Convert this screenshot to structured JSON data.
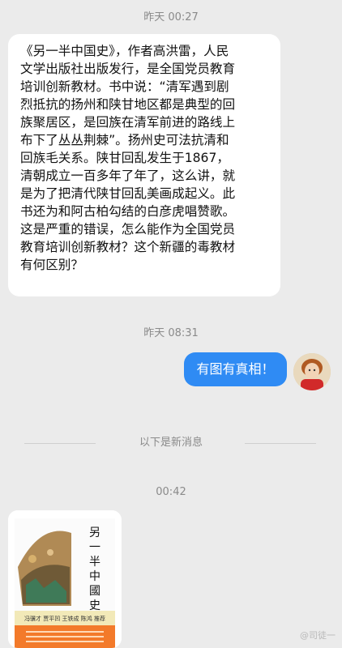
{
  "messages": [
    {
      "time": "昨天 00:27",
      "text": "《另一半中国史》，作者高洪雷，人民\n文学出版社出版发行，是全国党员教育\n培训创新教材。书中说：“清军遇到剧\n烈抵抗的扬州和陕甘地区都是典型的回\n族聚居区，是回族在清军前进的路线上\n布下了丛丛荆棘”。扬州史可法抗清和\n回族毛关系。陕甘回乱发生于1867，\n清朝成立一百多年了年了，这么讲，就\n是为了把清代陕甘回乱美画成起义。此\n书还为和阿古柏勾结的白彦虎唱赞歌。\n这是严重的错误，怎么能作为全国党员\n教育培训创新教材？这个新疆的毒教材\n有何区别？"
    },
    {
      "time": "昨天 08:31",
      "text": "有图有真相！"
    }
  ],
  "divider_label": "以下是新消息",
  "time_3": "00:42",
  "book_cover": {
    "title_chars": [
      "另",
      "一",
      "半",
      "中",
      "國",
      "史"
    ],
    "names": "冯骥才 贾平凹 王铁成 陈鸿 推荐"
  },
  "watermark": "@司徒一"
}
